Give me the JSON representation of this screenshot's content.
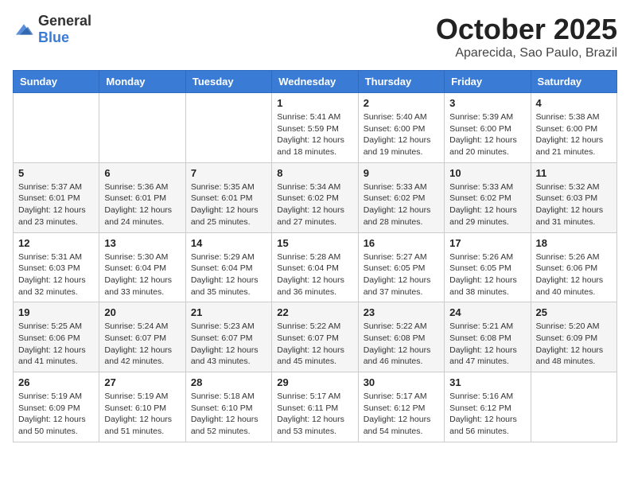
{
  "logo": {
    "general": "General",
    "blue": "Blue"
  },
  "header": {
    "month": "October 2025",
    "location": "Aparecida, Sao Paulo, Brazil"
  },
  "days_of_week": [
    "Sunday",
    "Monday",
    "Tuesday",
    "Wednesday",
    "Thursday",
    "Friday",
    "Saturday"
  ],
  "weeks": [
    [
      {
        "day": "",
        "info": ""
      },
      {
        "day": "",
        "info": ""
      },
      {
        "day": "",
        "info": ""
      },
      {
        "day": "1",
        "info": "Sunrise: 5:41 AM\nSunset: 5:59 PM\nDaylight: 12 hours and 18 minutes."
      },
      {
        "day": "2",
        "info": "Sunrise: 5:40 AM\nSunset: 6:00 PM\nDaylight: 12 hours and 19 minutes."
      },
      {
        "day": "3",
        "info": "Sunrise: 5:39 AM\nSunset: 6:00 PM\nDaylight: 12 hours and 20 minutes."
      },
      {
        "day": "4",
        "info": "Sunrise: 5:38 AM\nSunset: 6:00 PM\nDaylight: 12 hours and 21 minutes."
      }
    ],
    [
      {
        "day": "5",
        "info": "Sunrise: 5:37 AM\nSunset: 6:01 PM\nDaylight: 12 hours and 23 minutes."
      },
      {
        "day": "6",
        "info": "Sunrise: 5:36 AM\nSunset: 6:01 PM\nDaylight: 12 hours and 24 minutes."
      },
      {
        "day": "7",
        "info": "Sunrise: 5:35 AM\nSunset: 6:01 PM\nDaylight: 12 hours and 25 minutes."
      },
      {
        "day": "8",
        "info": "Sunrise: 5:34 AM\nSunset: 6:02 PM\nDaylight: 12 hours and 27 minutes."
      },
      {
        "day": "9",
        "info": "Sunrise: 5:33 AM\nSunset: 6:02 PM\nDaylight: 12 hours and 28 minutes."
      },
      {
        "day": "10",
        "info": "Sunrise: 5:33 AM\nSunset: 6:02 PM\nDaylight: 12 hours and 29 minutes."
      },
      {
        "day": "11",
        "info": "Sunrise: 5:32 AM\nSunset: 6:03 PM\nDaylight: 12 hours and 31 minutes."
      }
    ],
    [
      {
        "day": "12",
        "info": "Sunrise: 5:31 AM\nSunset: 6:03 PM\nDaylight: 12 hours and 32 minutes."
      },
      {
        "day": "13",
        "info": "Sunrise: 5:30 AM\nSunset: 6:04 PM\nDaylight: 12 hours and 33 minutes."
      },
      {
        "day": "14",
        "info": "Sunrise: 5:29 AM\nSunset: 6:04 PM\nDaylight: 12 hours and 35 minutes."
      },
      {
        "day": "15",
        "info": "Sunrise: 5:28 AM\nSunset: 6:04 PM\nDaylight: 12 hours and 36 minutes."
      },
      {
        "day": "16",
        "info": "Sunrise: 5:27 AM\nSunset: 6:05 PM\nDaylight: 12 hours and 37 minutes."
      },
      {
        "day": "17",
        "info": "Sunrise: 5:26 AM\nSunset: 6:05 PM\nDaylight: 12 hours and 38 minutes."
      },
      {
        "day": "18",
        "info": "Sunrise: 5:26 AM\nSunset: 6:06 PM\nDaylight: 12 hours and 40 minutes."
      }
    ],
    [
      {
        "day": "19",
        "info": "Sunrise: 5:25 AM\nSunset: 6:06 PM\nDaylight: 12 hours and 41 minutes."
      },
      {
        "day": "20",
        "info": "Sunrise: 5:24 AM\nSunset: 6:07 PM\nDaylight: 12 hours and 42 minutes."
      },
      {
        "day": "21",
        "info": "Sunrise: 5:23 AM\nSunset: 6:07 PM\nDaylight: 12 hours and 43 minutes."
      },
      {
        "day": "22",
        "info": "Sunrise: 5:22 AM\nSunset: 6:07 PM\nDaylight: 12 hours and 45 minutes."
      },
      {
        "day": "23",
        "info": "Sunrise: 5:22 AM\nSunset: 6:08 PM\nDaylight: 12 hours and 46 minutes."
      },
      {
        "day": "24",
        "info": "Sunrise: 5:21 AM\nSunset: 6:08 PM\nDaylight: 12 hours and 47 minutes."
      },
      {
        "day": "25",
        "info": "Sunrise: 5:20 AM\nSunset: 6:09 PM\nDaylight: 12 hours and 48 minutes."
      }
    ],
    [
      {
        "day": "26",
        "info": "Sunrise: 5:19 AM\nSunset: 6:09 PM\nDaylight: 12 hours and 50 minutes."
      },
      {
        "day": "27",
        "info": "Sunrise: 5:19 AM\nSunset: 6:10 PM\nDaylight: 12 hours and 51 minutes."
      },
      {
        "day": "28",
        "info": "Sunrise: 5:18 AM\nSunset: 6:10 PM\nDaylight: 12 hours and 52 minutes."
      },
      {
        "day": "29",
        "info": "Sunrise: 5:17 AM\nSunset: 6:11 PM\nDaylight: 12 hours and 53 minutes."
      },
      {
        "day": "30",
        "info": "Sunrise: 5:17 AM\nSunset: 6:12 PM\nDaylight: 12 hours and 54 minutes."
      },
      {
        "day": "31",
        "info": "Sunrise: 5:16 AM\nSunset: 6:12 PM\nDaylight: 12 hours and 56 minutes."
      },
      {
        "day": "",
        "info": ""
      }
    ]
  ]
}
